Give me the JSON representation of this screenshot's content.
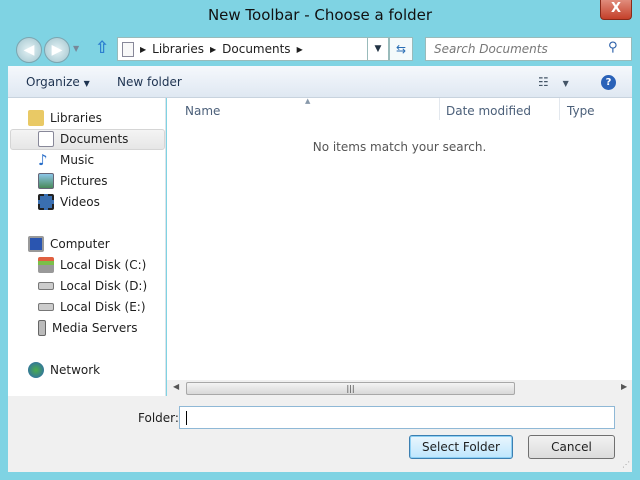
{
  "window": {
    "title": "New Toolbar - Choose a folder",
    "close_label": "X"
  },
  "nav": {
    "breadcrumb": [
      "Libraries",
      "Documents"
    ],
    "search_placeholder": "Search Documents"
  },
  "toolbar": {
    "organize": "Organize",
    "new_folder": "New folder"
  },
  "sidebar": {
    "libraries": "Libraries",
    "library_items": [
      "Documents",
      "Music",
      "Pictures",
      "Videos"
    ],
    "computer": "Computer",
    "computer_items": [
      "Local Disk (C:)",
      "Local Disk (D:)",
      "Local Disk (E:)",
      "Media Servers"
    ],
    "network": "Network"
  },
  "list": {
    "columns": [
      "Name",
      "Date modified",
      "Type"
    ],
    "empty_message": "No items match your search."
  },
  "footer": {
    "folder_label": "Folder:",
    "folder_value": "",
    "select_button": "Select Folder",
    "cancel_button": "Cancel"
  }
}
